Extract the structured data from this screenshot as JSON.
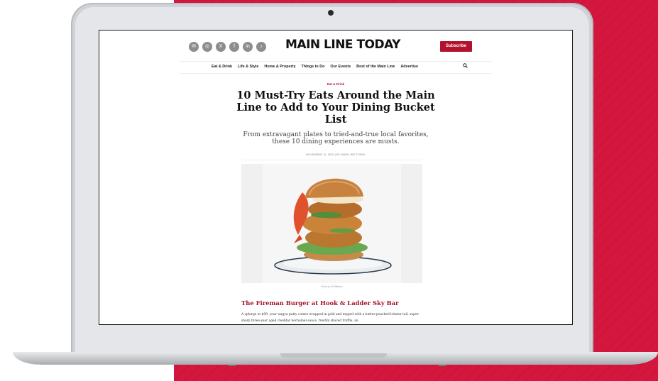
{
  "site": {
    "logo": "MAIN LINE TODAY",
    "subscribe_label": "Subscribe",
    "social": [
      {
        "icon": "email-icon",
        "glyph": "✉"
      },
      {
        "icon": "instagram-icon",
        "glyph": "◎"
      },
      {
        "icon": "x-icon",
        "glyph": "X"
      },
      {
        "icon": "facebook-icon",
        "glyph": "f"
      },
      {
        "icon": "linkedin-icon",
        "glyph": "in"
      },
      {
        "icon": "tiktok-icon",
        "glyph": "♪"
      }
    ],
    "nav": [
      "Eat & Drink",
      "Life & Style",
      "Home & Property",
      "Things to Do",
      "Our Events",
      "Best of the Main Line",
      "Advertise"
    ],
    "accent_color": "#b3122e"
  },
  "article": {
    "category": "Eat & Drink",
    "headline": "10 Must-Try Eats Around the Main Line to Add to Your Dining Bucket List",
    "dek": "From extravagant plates to tried-and-true local favorites, these 10 dining experiences are musts.",
    "byline": "NOVEMBER 11, 2025  |  BY MAIN LINE TODAY",
    "photo_credit": "Photo by Ed Williams",
    "subhead": "The Fireman Burger at Hook & Ladder Sky Bar",
    "body": "A splurge at $99, your wagyu patty comes wrapped in gold and topped with a butter-poached lobster tail, super-sharp three-year aged cheddar béchamel sauce, freshly shaved truffle, an"
  }
}
